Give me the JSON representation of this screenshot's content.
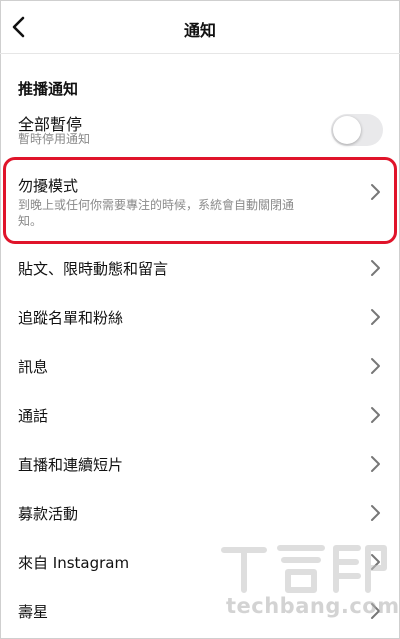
{
  "nav": {
    "title": "通知"
  },
  "push": {
    "section_title": "推播通知",
    "pause_all": {
      "title": "全部暫停",
      "subtitle": "暫時停用通知",
      "toggle_on": false
    },
    "quiet_mode": {
      "title": "勿擾模式",
      "subtitle_line1": "到晚上或任何你需要專注的時候，系統會自動關閉通",
      "subtitle_line2": "知。"
    },
    "items": [
      "貼文、限時動態和留言",
      "追蹤名單和粉絲",
      "訊息",
      "通話",
      "直播和連續短片",
      "募款活動",
      "來自 Instagram",
      "壽星"
    ]
  },
  "watermark": {
    "text": "techbang.com"
  },
  "colors": {
    "highlight": "#e0142a",
    "toggle_off": "#e9e9eb",
    "subtitle": "#8a8a8a"
  }
}
